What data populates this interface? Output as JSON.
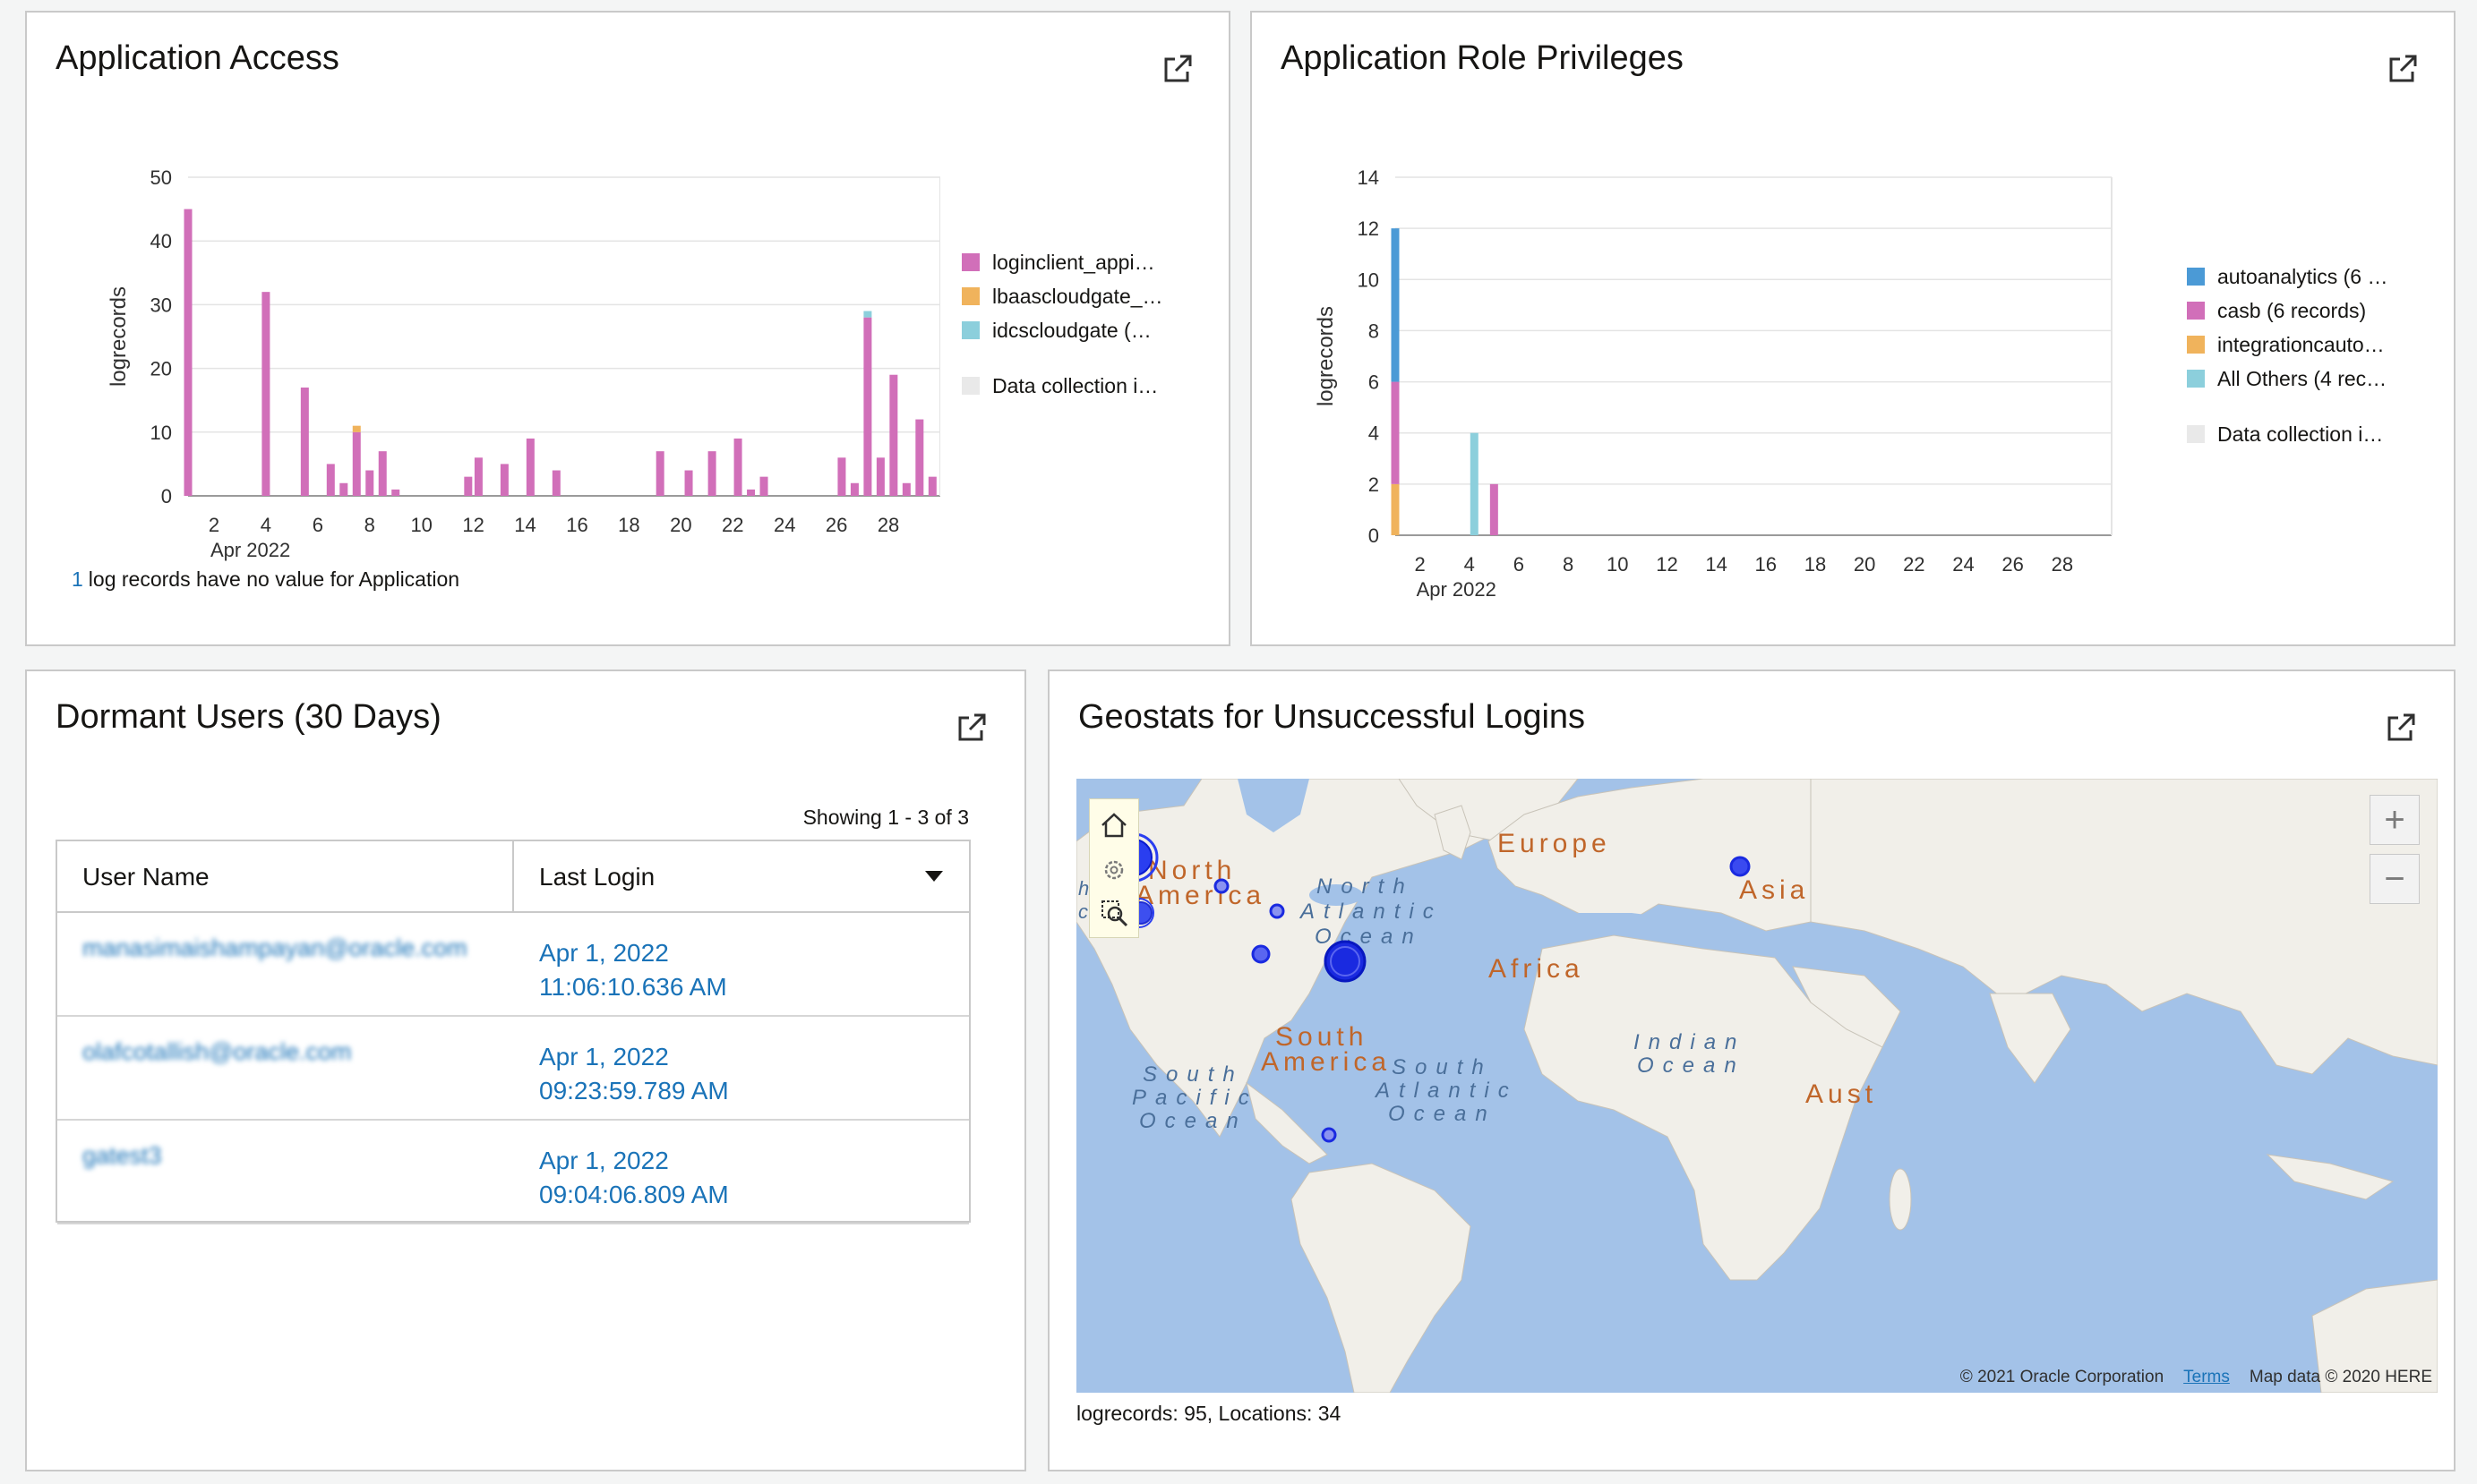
{
  "panels": {
    "app_access": {
      "title": "Application Access",
      "note_count": "1",
      "note_text": "log records have no value for Application",
      "legend": [
        {
          "label": "loginclient_appi…",
          "color": "#d16fb9"
        },
        {
          "label": "lbaascloudgate_…",
          "color": "#f0b35c"
        },
        {
          "label": "idcscloudgate (…",
          "color": "#8ccfdc"
        },
        {
          "label": "Data collection i…",
          "color": "#e9e9e9"
        }
      ]
    },
    "role_priv": {
      "title": "Application Role Privileges",
      "legend": [
        {
          "label": "autoanalytics (6 …",
          "color": "#4b9ad6"
        },
        {
          "label": "casb (6 records)",
          "color": "#d16fb9"
        },
        {
          "label": "integrationcauto…",
          "color": "#f0b35c"
        },
        {
          "label": "All Others (4 rec…",
          "color": "#8ccfdc"
        },
        {
          "label": "Data collection i…",
          "color": "#e9e9e9"
        }
      ]
    },
    "dormant": {
      "title": "Dormant Users (30 Days)",
      "showing": "Showing 1 - 3 of 3",
      "columns": [
        "User Name",
        "Last Login"
      ],
      "rows": [
        {
          "user": "manasimaishampayan@oracle.com",
          "login_date": "Apr 1, 2022",
          "login_time": "11:06:10.636 AM"
        },
        {
          "user": "olafcotallish@oracle.com",
          "login_date": "Apr 1, 2022",
          "login_time": "09:23:59.789 AM"
        },
        {
          "user": "gatest3",
          "login_date": "Apr 1, 2022",
          "login_time": "09:04:06.809 AM"
        }
      ]
    },
    "geostats": {
      "title": "Geostats for Unsuccessful Logins",
      "footer": "logrecords: 95, Locations: 34",
      "credit_left": "© 2021 Oracle Corporation",
      "credit_terms": "Terms",
      "credit_right": "Map data © 2020 HERE",
      "zoom_in": "+",
      "zoom_out": "−",
      "labels": {
        "north1": "North",
        "north2": "America",
        "europe": "Europe",
        "asia": "Asia",
        "africa": "Africa",
        "south1": "South",
        "south2": "America",
        "aus": "Aust",
        "natl1": "North",
        "natl2": "Atlantic",
        "natl3": "Ocean",
        "satl1": "South",
        "satl2": "Atlantic",
        "satl3": "Ocean",
        "spac1": "South",
        "spac2": "Pacific",
        "spac3": "Ocean",
        "ind1": "Indian",
        "ind2": "Ocean",
        "west1": "h",
        "west2": "c"
      }
    }
  },
  "chart_data": [
    {
      "type": "bar",
      "stacked": true,
      "ylabel": "logrecords",
      "ylim": [
        0,
        50
      ],
      "yticks": [
        0,
        10,
        20,
        30,
        40,
        50
      ],
      "xticks": [
        2,
        4,
        6,
        8,
        10,
        12,
        14,
        16,
        18,
        20,
        22,
        24,
        26,
        28
      ],
      "xlim": [
        1,
        30
      ],
      "x_sublabel": "Apr 2022",
      "grid": true,
      "legend_position": "right",
      "series": [
        {
          "name": "loginclient_appi…",
          "color": "#d16fb9",
          "points": [
            [
              1,
              45
            ],
            [
              4,
              32
            ],
            [
              5.5,
              17
            ],
            [
              6.5,
              5
            ],
            [
              7,
              2
            ],
            [
              7.5,
              10
            ],
            [
              8,
              4
            ],
            [
              8.5,
              7
            ],
            [
              9,
              1
            ],
            [
              11.8,
              3
            ],
            [
              12.2,
              6
            ],
            [
              13.2,
              5
            ],
            [
              14.2,
              9
            ],
            [
              15.2,
              4
            ],
            [
              19.2,
              7
            ],
            [
              20.3,
              4
            ],
            [
              21.2,
              7
            ],
            [
              22.2,
              9
            ],
            [
              22.7,
              1
            ],
            [
              23.2,
              3
            ],
            [
              26.2,
              6
            ],
            [
              26.7,
              2
            ],
            [
              27.2,
              28
            ],
            [
              27.7,
              6
            ],
            [
              28.2,
              19
            ],
            [
              28.7,
              2
            ],
            [
              29.2,
              12
            ],
            [
              29.7,
              3
            ]
          ]
        },
        {
          "name": "lbaascloudgate_…",
          "color": "#f0b35c",
          "points": [
            [
              7.5,
              1
            ]
          ]
        },
        {
          "name": "idcscloudgate (…",
          "color": "#8ccfdc",
          "points": [
            [
              27.2,
              1
            ]
          ]
        }
      ]
    },
    {
      "type": "bar",
      "stacked": true,
      "ylabel": "logrecords",
      "ylim": [
        0,
        14
      ],
      "yticks": [
        0,
        2,
        4,
        6,
        8,
        10,
        12,
        14
      ],
      "xticks": [
        2,
        4,
        6,
        8,
        10,
        12,
        14,
        16,
        18,
        20,
        22,
        24,
        26,
        28
      ],
      "xlim": [
        1,
        30
      ],
      "x_sublabel": "Apr 2022",
      "grid": true,
      "legend_position": "right",
      "series": [
        {
          "name": "integrationcauto…",
          "color": "#f0b35c",
          "points": [
            [
              1,
              2
            ]
          ]
        },
        {
          "name": "casb (6 records)",
          "color": "#d16fb9",
          "points": [
            [
              1,
              4
            ],
            [
              5,
              2
            ]
          ]
        },
        {
          "name": "autoanalytics (6 …",
          "color": "#4b9ad6",
          "points": [
            [
              1,
              6
            ]
          ]
        },
        {
          "name": "All Others (4 rec…",
          "color": "#8ccfdc",
          "points": [
            [
              4.2,
              4
            ]
          ]
        }
      ]
    }
  ]
}
